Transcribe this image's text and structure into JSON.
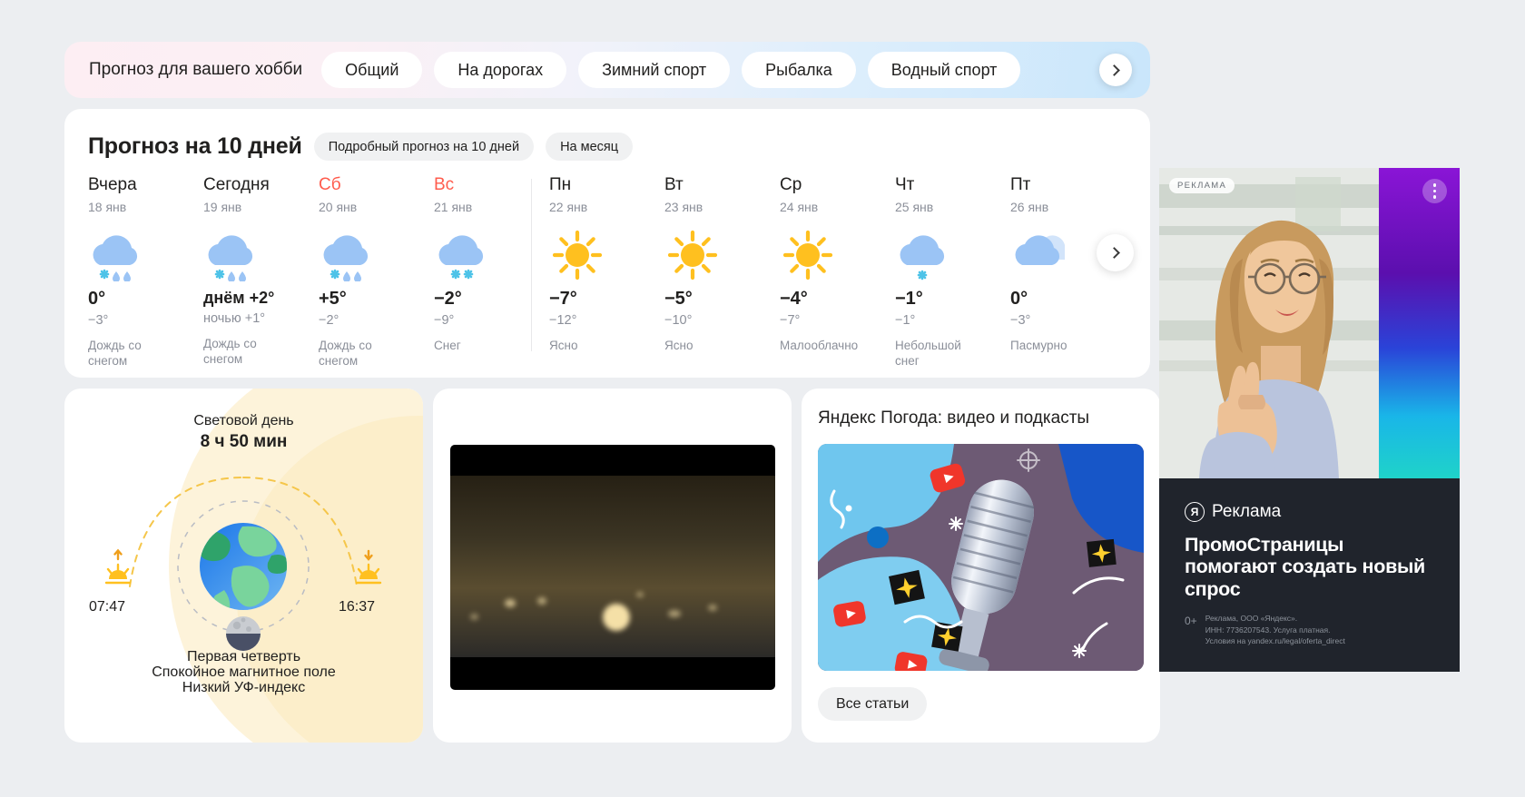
{
  "hobby_bar": {
    "label": "Прогноз для вашего хобби",
    "chips": [
      "Общий",
      "На дорогах",
      "Зимний спорт",
      "Рыбалка",
      "Водный спорт"
    ],
    "next_icon": "chevron-right-icon"
  },
  "forecast": {
    "title": "Прогноз на 10 дней",
    "pills": [
      "Подробный прогноз на 10 дней",
      "На месяц"
    ],
    "next_icon": "chevron-right-icon",
    "days": [
      {
        "name": "Вчера",
        "date": "18 янв",
        "weekend": false,
        "icon": "rain-snow-cloud-icon",
        "temp": "0°",
        "temp2": "−3°",
        "cond": "Дождь со снегом",
        "divider": false
      },
      {
        "name": "Сегодня",
        "date": "19 янв",
        "weekend": false,
        "icon": "rain-snow-cloud-icon",
        "temp": "днём +2°",
        "temp2": "ночью +1°",
        "cond": "Дождь со снегом",
        "divider": false
      },
      {
        "name": "Сб",
        "date": "20 янв",
        "weekend": true,
        "icon": "rain-snow-cloud-icon",
        "temp": "+5°",
        "temp2": "−2°",
        "cond": "Дождь со снегом",
        "divider": false
      },
      {
        "name": "Вс",
        "date": "21 янв",
        "weekend": true,
        "icon": "snow-cloud-icon",
        "temp": "−2°",
        "temp2": "−9°",
        "cond": "Снег",
        "divider": false
      },
      {
        "name": "Пн",
        "date": "22 янв",
        "weekend": false,
        "icon": "sun-icon",
        "temp": "−7°",
        "temp2": "−12°",
        "cond": "Ясно",
        "divider": true
      },
      {
        "name": "Вт",
        "date": "23 янв",
        "weekend": false,
        "icon": "sun-icon",
        "temp": "−5°",
        "temp2": "−10°",
        "cond": "Ясно",
        "divider": false
      },
      {
        "name": "Ср",
        "date": "24 янв",
        "weekend": false,
        "icon": "sun-icon",
        "temp": "−4°",
        "temp2": "−7°",
        "cond": "Малооблачно",
        "divider": false
      },
      {
        "name": "Чт",
        "date": "25 янв",
        "weekend": false,
        "icon": "light-snow-cloud-icon",
        "temp": "−1°",
        "temp2": "−1°",
        "cond": "Небольшой снег",
        "divider": false
      },
      {
        "name": "Пт",
        "date": "26 янв",
        "weekend": false,
        "icon": "overcast-icon",
        "temp": "0°",
        "temp2": "−3°",
        "cond": "Пасмурно",
        "divider": false
      }
    ]
  },
  "sun_card": {
    "daylight_label": "Световой день",
    "daylight_value": "8 ч 50 мин",
    "sunrise": "07:47",
    "sunset": "16:37",
    "sunrise_icon": "sunrise-icon",
    "sunset_icon": "sunset-icon",
    "earth_icon": "earth-globe-icon",
    "moon_icon": "moon-first-quarter-icon",
    "moon_phase": "Первая четверть",
    "magnetic": "Спокойное магнитное поле",
    "uv": "Низкий УФ-индекс"
  },
  "video_card": {
    "thumbnail": "night-city-webcam-thumbnail"
  },
  "podcast_card": {
    "title": "Яндекс Погода: видео и подкасты",
    "artwork": "microphone-illustration",
    "button": "Все статьи"
  },
  "ad": {
    "badge": "РЕКЛАМА",
    "menu_icon": "three-dots-icon",
    "brand": "Реклама",
    "brand_mark": "Я",
    "headline": "ПромоСтраницы помогают создать новый спрос",
    "age": "0+",
    "disclaimer": "Реклама, ООО «Яндекс».\nИНН: 7736207543. Услуга платная.\nУсловия на yandex.ru/legal/oferta_direct"
  },
  "colors": {
    "accent_weekend": "#ff5c4d",
    "cloud": "#9bc4f5",
    "sun": "#ffc01f",
    "snow": "#4ec3e8",
    "card": "#ffffff",
    "page_bg": "#eceef1"
  }
}
